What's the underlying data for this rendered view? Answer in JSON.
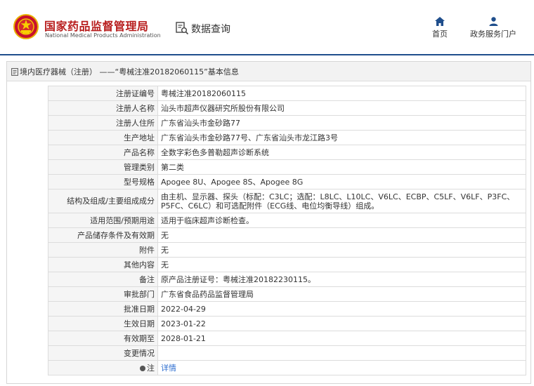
{
  "header": {
    "logo_cn": "国家药品监督管理局",
    "logo_en": "National Medical Products Administration",
    "data_query_label": "数据查询",
    "nav": [
      {
        "label": "首页",
        "icon": "home-icon"
      },
      {
        "label": "政务服务门户",
        "icon": "user-icon"
      }
    ]
  },
  "breadcrumb": {
    "link": "境内医疗器械（注册）",
    "sep": "——",
    "current": "“粤械注准20182060115”基本信息"
  },
  "colors": {
    "brand_red": "#b81e1e",
    "header_rule": "#1f4e8c",
    "link": "#2f6fd0"
  },
  "fields": [
    {
      "label": "注册证编号",
      "value": "粤械注准20182060115"
    },
    {
      "label": "注册人名称",
      "value": "汕头市超声仪器研究所股份有限公司"
    },
    {
      "label": "注册人住所",
      "value": "广东省汕头市金砂路77"
    },
    {
      "label": "生产地址",
      "value": "广东省汕头市金砂路77号、广东省汕头市龙江路3号"
    },
    {
      "label": "产品名称",
      "value": "全数字彩色多普勒超声诊断系统"
    },
    {
      "label": "管理类别",
      "value": "第二类"
    },
    {
      "label": "型号规格",
      "value": "Apogee 8U、Apogee 8S、Apogee 8G"
    },
    {
      "label": "结构及组成/主要组成成分",
      "value": "由主机、显示器、探头（标配：C3LC；选配：L8LC、L10LC、V6LC、ECBP、C5LF、V6LF、P3FC、P5FC、C6LC）和可选配附件（ECG线、电位均衡导线）组成。"
    },
    {
      "label": "适用范围/预期用途",
      "value": "适用于临床超声诊断检查。"
    },
    {
      "label": "产品储存条件及有效期",
      "value": "无"
    },
    {
      "label": "附件",
      "value": "无"
    },
    {
      "label": "其他内容",
      "value": "无"
    },
    {
      "label": "备注",
      "value": "原产品注册证号：粤械注准20182230115。"
    },
    {
      "label": "审批部门",
      "value": "广东省食品药品监督管理局"
    },
    {
      "label": "批准日期",
      "value": "2022-04-29"
    },
    {
      "label": "生效日期",
      "value": "2023-01-22"
    },
    {
      "label": "有效期至",
      "value": "2028-01-21"
    },
    {
      "label": "变更情况",
      "value": ""
    }
  ],
  "note_row": {
    "label": "注",
    "value": "详情"
  }
}
